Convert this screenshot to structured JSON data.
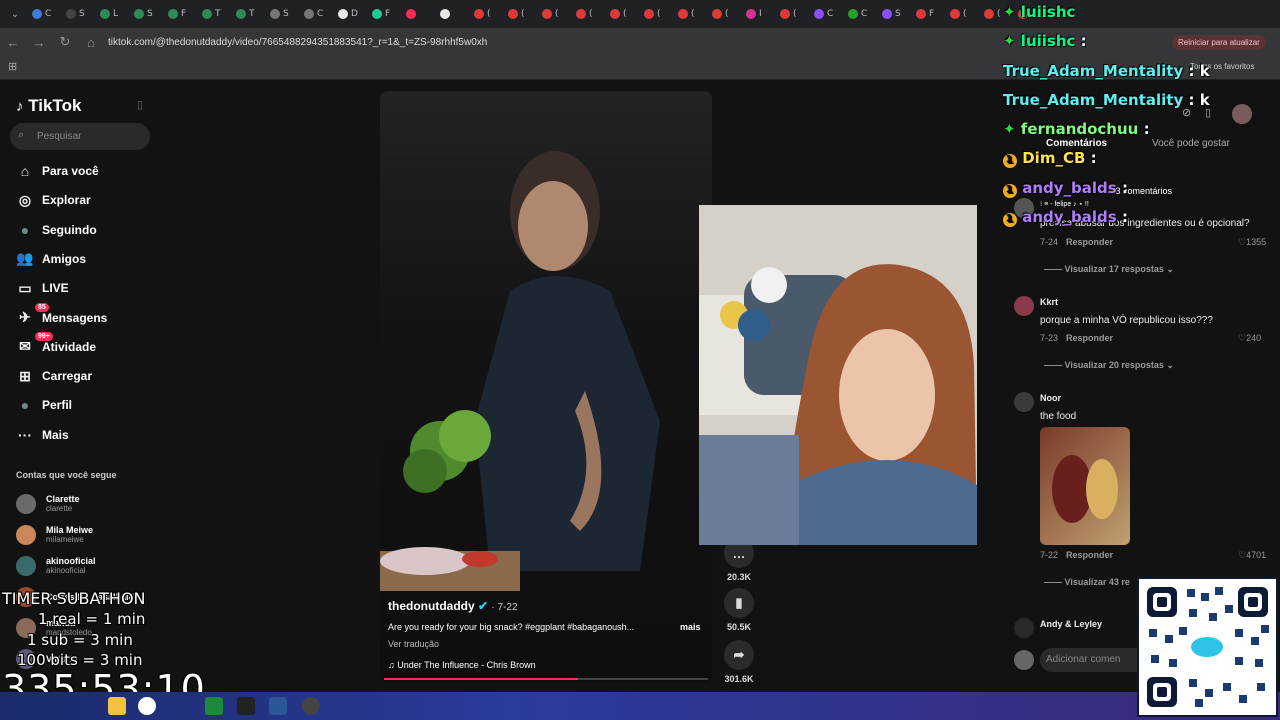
{
  "browser": {
    "url": "tiktok.com/@thedonutdaddy/video/7665488294351883541?_r=1&_t=ZS-98rhhf5w0xh",
    "restart_label": "Reiniciar para atualizar",
    "bookmarks_label": "Todos os favoritos",
    "tabs": [
      {
        "label": "C",
        "color": "#3b7dd8"
      },
      {
        "label": "S",
        "color": "#444"
      },
      {
        "label": "L",
        "color": "#2e8b57"
      },
      {
        "label": "S",
        "color": "#2e8b57"
      },
      {
        "label": "F",
        "color": "#2e8b57"
      },
      {
        "label": "T",
        "color": "#2e8b57"
      },
      {
        "label": "T",
        "color": "#2e8b57"
      },
      {
        "label": "S",
        "color": "#777"
      },
      {
        "label": "C",
        "color": "#777"
      },
      {
        "label": "D",
        "color": "#e8e8e8"
      },
      {
        "label": "F",
        "color": "#20c997"
      },
      {
        "label": "",
        "color": "#fe2c55"
      },
      {
        "label": "",
        "color": "#e8e8e8"
      },
      {
        "label": "(",
        "color": "#e03a3a"
      },
      {
        "label": "(",
        "color": "#e03a3a"
      },
      {
        "label": "(",
        "color": "#e03a3a"
      },
      {
        "label": "(",
        "color": "#e03a3a"
      },
      {
        "label": "(",
        "color": "#e03a3a"
      },
      {
        "label": "(",
        "color": "#e03a3a"
      },
      {
        "label": "(",
        "color": "#e03a3a"
      },
      {
        "label": "(",
        "color": "#e03a3a"
      },
      {
        "label": "I",
        "color": "#d6338f"
      },
      {
        "label": "(",
        "color": "#e03a3a"
      },
      {
        "label": "C",
        "color": "#8a4fff"
      },
      {
        "label": "C",
        "color": "#2aa02a"
      },
      {
        "label": "S",
        "color": "#8a4fff"
      },
      {
        "label": "F",
        "color": "#e03a3a"
      },
      {
        "label": "(",
        "color": "#e03a3a"
      },
      {
        "label": "(",
        "color": "#e03a3a"
      },
      {
        "label": "(",
        "color": "#e03a3a"
      }
    ]
  },
  "sidebar": {
    "logo": "TikTok",
    "search_placeholder": "Pesquisar",
    "nav": [
      {
        "label": "Para você",
        "icon": "home-icon",
        "glyph": "⌂"
      },
      {
        "label": "Explorar",
        "icon": "compass-icon",
        "glyph": "◎"
      },
      {
        "label": "Seguindo",
        "icon": "following-avatar-icon",
        "glyph": "●"
      },
      {
        "label": "Amigos",
        "icon": "friends-icon",
        "glyph": "👥"
      },
      {
        "label": "LIVE",
        "icon": "live-icon",
        "glyph": "▭"
      },
      {
        "label": "Mensagens",
        "icon": "messages-icon",
        "glyph": "✈",
        "badge": "85"
      },
      {
        "label": "Atividade",
        "icon": "activity-icon",
        "glyph": "✉",
        "badge": "99+"
      },
      {
        "label": "Carregar",
        "icon": "upload-icon",
        "glyph": "⊞"
      },
      {
        "label": "Perfil",
        "icon": "profile-avatar-icon",
        "glyph": "●"
      },
      {
        "label": "Mais",
        "icon": "more-icon",
        "glyph": "···"
      }
    ],
    "following_heading": "Contas que você segue",
    "following": [
      {
        "name": "Clarette",
        "handle": "clarette"
      },
      {
        "name": "Mila Meiwe",
        "handle": "milameiwe"
      },
      {
        "name": "akinooficial",
        "handle": "akinooficial"
      },
      {
        "name": "Cortes Do Casalbaldo",
        "handle": ""
      },
      {
        "name": "manda",
        "handle": "mandstoledo"
      },
      {
        "name": "Vittorio",
        "handle": ""
      }
    ]
  },
  "video": {
    "author": "thedonutdaddy",
    "date": "· 7-22",
    "caption": "Are you ready for your big snack? #eggplant #babaganoush...",
    "more": "mais",
    "translate": "Ver tradução",
    "music": "Under The Influence - Chris Brown",
    "progress": 0.6
  },
  "actions": [
    {
      "icon": "comment-icon",
      "glyph": "…",
      "count": "20.3K"
    },
    {
      "icon": "bookmark-icon",
      "glyph": "▮",
      "count": "50.5K"
    },
    {
      "icon": "share-icon",
      "glyph": "➦",
      "count": "301.6K"
    }
  ],
  "comments_panel": {
    "tab_comments": "Comentários",
    "tab_suggest": "Você pode gostar",
    "count_label": "4.3 comentários",
    "partial_comment": "precisa abusar dos ingredientes ou é opcional?",
    "first_meta": {
      "date": "7-24",
      "reply": "Responder",
      "likes": "1355",
      "view": "Visualizar 17 respostas"
    },
    "comments": [
      {
        "name": "Kkrt",
        "text": "porque a minha VÓ republicou isso???",
        "date": "7-23",
        "reply": "Responder",
        "likes": "240",
        "view": "Visualizar 20 respostas"
      },
      {
        "name": "Noor",
        "text": "the food",
        "date": "7-22",
        "reply": "Responder",
        "likes": "4701",
        "view": "Visualizar 43 re"
      },
      {
        "name": "Andy & Leyley",
        "text": "",
        "date": "",
        "reply": "",
        "likes": "",
        "view": ""
      }
    ],
    "add_placeholder": "Adicionar comen",
    "tag_line": "⁝ ≡ - felipe ♪ ⋆ !!"
  },
  "chat": [
    {
      "user": "luiishc",
      "msg": "",
      "color": "#00ff88",
      "badge": "diamond"
    },
    {
      "user": "luiishc",
      "msg": ":",
      "color": "#00ff88",
      "badge": "diamond"
    },
    {
      "user": "True_Adam_Mentality",
      "msg": ": k",
      "color": "#5cf0f0",
      "badge": ""
    },
    {
      "user": "True_Adam_Mentality",
      "msg": ": k",
      "color": "#5cf0f0",
      "badge": ""
    },
    {
      "user": "fernandochuu",
      "msg": ":",
      "color": "#7dff7d",
      "badge": "diamond"
    },
    {
      "user": "Dim_CB",
      "msg": ":",
      "color": "#ffe34d",
      "badge": "one"
    },
    {
      "user": "andy_balds",
      "msg": ":",
      "color": "#b07dff",
      "badge": "one"
    },
    {
      "user": "andy_balds",
      "msg": ":",
      "color": "#b07dff",
      "badge": "one"
    }
  ],
  "overlay": {
    "timer_title": "TIMER SUBATHON",
    "rule1": "1 real = 1 min",
    "rule2": "1 sub = 3 min",
    "rule3": "100 bits = 3 min",
    "timer": "335:53:10"
  }
}
